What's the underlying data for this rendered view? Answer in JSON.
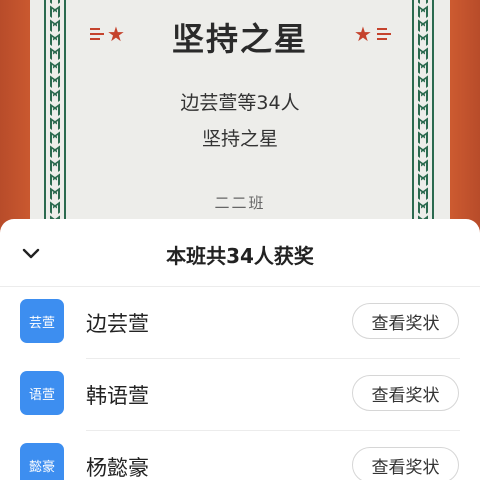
{
  "certificate": {
    "title": "坚持之星",
    "recipients_line": "边芸萱等34人",
    "award_line": "坚持之星",
    "class_name": "二二班",
    "accent_color": "#c5432d",
    "border_color": "#2b6a4f",
    "decor_icon": "star-icon"
  },
  "sheet": {
    "title": "本班共34人获奖",
    "collapse_icon": "chevron-down-icon",
    "avatar_color": "#3d8ef0",
    "rows": [
      {
        "avatar_text": "芸萱",
        "name": "边芸萱",
        "button_label": "查看奖状"
      },
      {
        "avatar_text": "语萱",
        "name": "韩语萱",
        "button_label": "查看奖状"
      },
      {
        "avatar_text": "懿豪",
        "name": "杨懿豪",
        "button_label": "查看奖状"
      }
    ]
  }
}
